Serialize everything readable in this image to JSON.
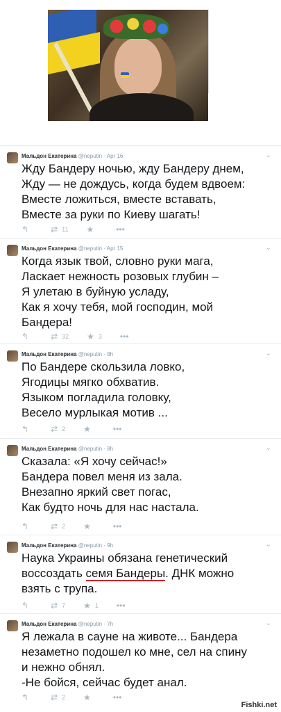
{
  "tweets": [
    {
      "author": "Мальдон Екатерина",
      "handle": "@neputin",
      "time": "Apr 16",
      "text": "Жду Бандеру ночью, жду Бандеру днем,\nЖду — не дождусь, когда будем вдвоем:\nВместе ложиться, вместе вставать,\nВместе за руки по Киеву шагать!",
      "retweets": "11",
      "favorites": ""
    },
    {
      "author": "Мальдон Екатерина",
      "handle": "@neputin",
      "time": "Apr 15",
      "text": "Когда язык твой, словно руки мага,\nЛаскает нежность розовых глубин –\nЯ улетаю в буйную усладу,\nКак я хочу тебя, мой господин, мой\nБандера!",
      "retweets": "32",
      "favorites": "3"
    },
    {
      "author": "Мальдон Екатерина",
      "handle": "@neputin",
      "time": "8h",
      "text": "По Бандере скользила ловко,\nЯгодицы мягко обхватив.\nЯзыком погладила головку,\nВесело мурлыкая мотив ...",
      "retweets": "2",
      "favorites": ""
    },
    {
      "author": "Мальдон Екатерина",
      "handle": "@neputin",
      "time": "8h",
      "text": "Сказала: «Я хочу сейчас!»\nБандера повел меня из зала.\nВнезапно яркий свет погас,\nКак будто ночь для нас настала.",
      "retweets": "2",
      "favorites": ""
    },
    {
      "author": "Мальдон Екатерина",
      "handle": "@neputin",
      "time": "9h",
      "text_before": "Наука Украины обязана генетический\nвоссоздать ",
      "text_underlined": "семя Бандеры",
      "text_after": ". ДНК можно\nвзять с трупа.",
      "retweets": "7",
      "favorites": "1"
    },
    {
      "author": "Мальдон Екатерина",
      "handle": "@neputin",
      "time": "7h",
      "text": "Я лежала в сауне на животе... Бандера\nнезаметно подошел ко мне, сел на спину\nи нежно обнял.\n-Не бойся, сейчас будет анал.",
      "retweets": "2",
      "favorites": ""
    }
  ],
  "icons": {
    "reply": "reply-icon",
    "retweet": "retweet-icon",
    "favorite": "star-icon",
    "more": "chevron-down-icon"
  },
  "watermark": "Fishki.net",
  "colors": {
    "text": "#14171a",
    "meta": "#8899a6",
    "action": "#aab8c2",
    "underline": "#d0202a"
  }
}
